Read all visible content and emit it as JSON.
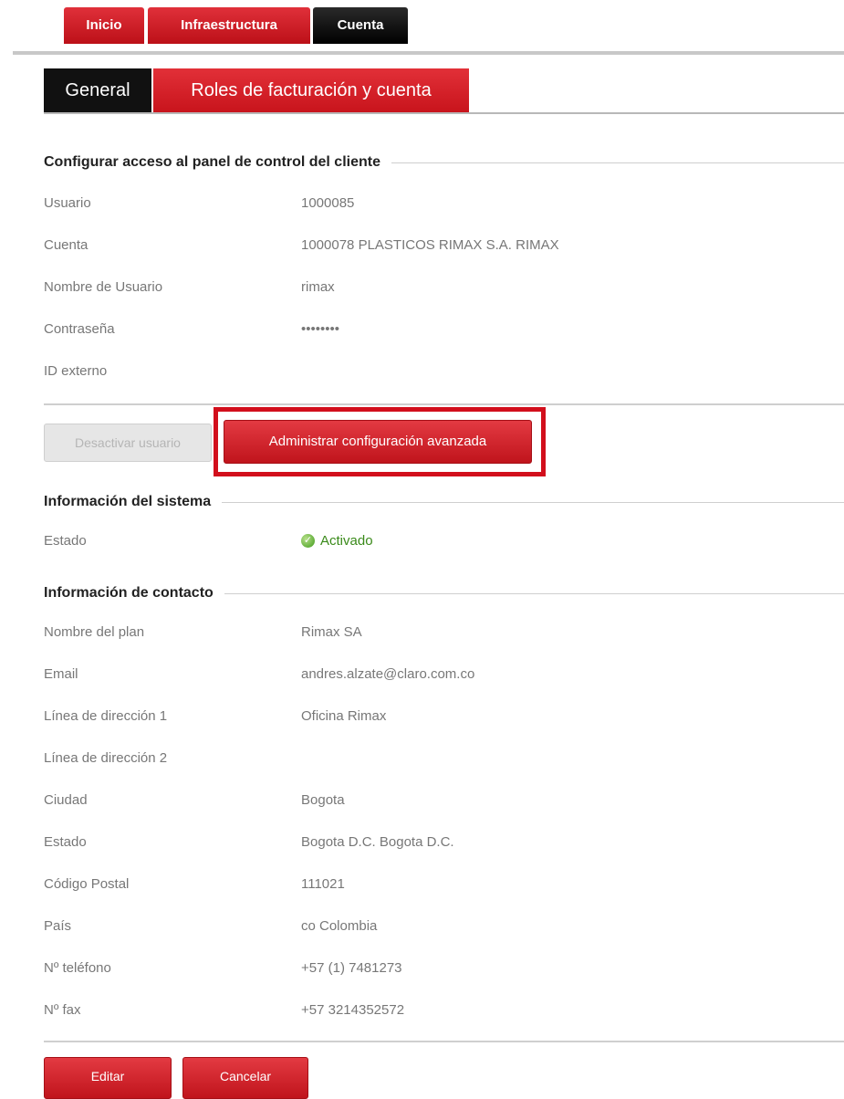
{
  "top_tabs": [
    "Inicio",
    "Infraestructura",
    "Cuenta"
  ],
  "sub_tabs": [
    "General",
    "Roles de facturación y cuenta"
  ],
  "access_section": {
    "title": "Configurar acceso al panel de control del cliente",
    "rows": [
      {
        "label": "Usuario",
        "value": "1000085"
      },
      {
        "label": "Cuenta",
        "value": "1000078 PLASTICOS RIMAX S.A. RIMAX"
      },
      {
        "label": "Nombre de Usuario",
        "value": "rimax"
      },
      {
        "label": "Contraseña",
        "value": "••••••••"
      },
      {
        "label": "ID externo",
        "value": ""
      }
    ]
  },
  "buttons": {
    "deactivate": "Desactivar usuario",
    "advanced": "Administrar configuración avanzada",
    "edit": "Editar",
    "cancel": "Cancelar"
  },
  "system_section": {
    "title": "Información del sistema",
    "status_label": "Estado",
    "status_value": "Activado",
    "status_icon": "check-circle-icon",
    "status_color": "#3f9a1a"
  },
  "contact_section": {
    "title": "Información de contacto",
    "rows": [
      {
        "label": "Nombre del plan",
        "value": "Rimax SA"
      },
      {
        "label": "Email",
        "value": "andres.alzate@claro.com.co"
      },
      {
        "label": "Línea de dirección 1",
        "value": "Oficina Rimax"
      },
      {
        "label": "Línea de dirección 2",
        "value": ""
      },
      {
        "label": "Ciudad",
        "value": "Bogota"
      },
      {
        "label": "Estado",
        "value": "Bogota D.C. Bogota D.C."
      },
      {
        "label": "Código Postal",
        "value": "111021"
      },
      {
        "label": "País",
        "value": "co Colombia"
      },
      {
        "label": "Nº teléfono",
        "value": "+57 (1) 7481273"
      },
      {
        "label": "Nº fax",
        "value": "+57 3214352572"
      }
    ]
  },
  "colors": {
    "accent_red": "#c8141c",
    "tab_black": "#111111",
    "highlight": "#d20f1c"
  }
}
